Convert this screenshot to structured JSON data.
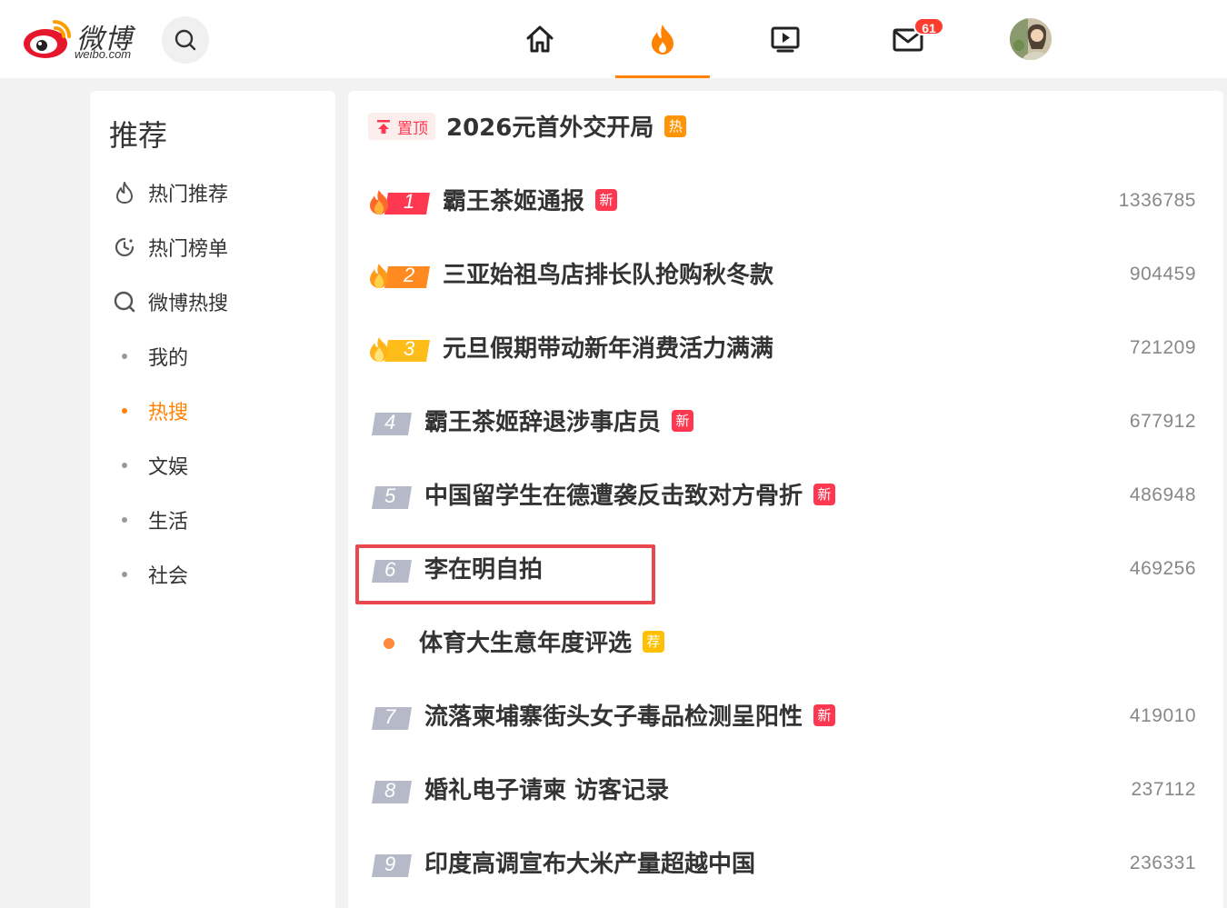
{
  "header": {
    "logo_text": "微博",
    "logo_subtext": "weibo.com",
    "message_badge": "61",
    "accent": "#ff8200",
    "nav": [
      {
        "icon": "home-icon"
      },
      {
        "icon": "hot-flame-icon",
        "active": true
      },
      {
        "icon": "video-icon"
      },
      {
        "icon": "mail-icon"
      }
    ]
  },
  "sidebar": {
    "title": "推荐",
    "items": [
      {
        "label": "热门推荐",
        "icon": "flame-outline-icon"
      },
      {
        "label": "热门榜单",
        "icon": "clock-icon"
      },
      {
        "label": "微博热搜",
        "icon": "search-circle-icon"
      },
      {
        "label": "我的"
      },
      {
        "label": "热搜",
        "active": true
      },
      {
        "label": "文娱"
      },
      {
        "label": "生活"
      },
      {
        "label": "社会"
      }
    ]
  },
  "hot_list": {
    "pinned": {
      "label": "置顶",
      "title": "2026元首外交开局",
      "tag": "热"
    },
    "rows": [
      {
        "rank": "1",
        "title": "霸王茶姬通报",
        "tag": "新",
        "count": "1336785"
      },
      {
        "rank": "2",
        "title": "三亚始祖鸟店排长队抢购秋冬款",
        "tag": "",
        "count": "904459"
      },
      {
        "rank": "3",
        "title": "元旦假期带动新年消费活力满满",
        "tag": "",
        "count": "721209"
      },
      {
        "rank": "4",
        "title": "霸王茶姬辞退涉事店员",
        "tag": "新",
        "count": "677912"
      },
      {
        "rank": "5",
        "title": "中国留学生在德遭袭反击致对方骨折",
        "tag": "新",
        "count": "486948"
      },
      {
        "rank": "6",
        "title": "李在明自拍",
        "tag": "",
        "count": "469256"
      },
      {
        "rank": "",
        "title": "体育大生意年度评选",
        "tag": "荐",
        "count": ""
      },
      {
        "rank": "7",
        "title": "流落柬埔寨街头女子毒品检测呈阳性",
        "tag": "新",
        "count": "419010"
      },
      {
        "rank": "8",
        "title": "婚礼电子请柬 访客记录",
        "tag": "",
        "count": "237112"
      },
      {
        "rank": "9",
        "title": "印度高调宣布大米产量超越中国",
        "tag": "",
        "count": "236331"
      }
    ]
  }
}
